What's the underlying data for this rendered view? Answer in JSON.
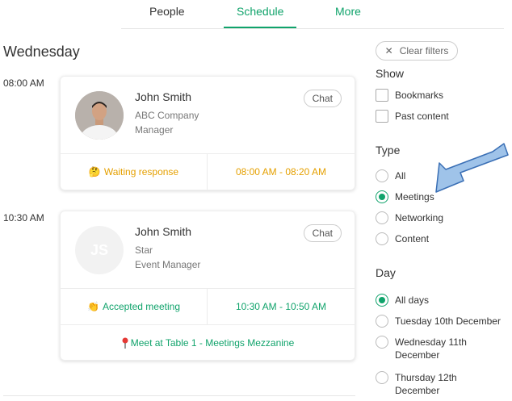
{
  "tabs": [
    {
      "label": "People"
    },
    {
      "label": "Schedule"
    },
    {
      "label": "More"
    }
  ],
  "day_title": "Wednesday",
  "meetings": [
    {
      "time": "08:00 AM",
      "name": "John Smith",
      "line1": "ABC Company",
      "line2": "Manager",
      "chat": "Chat",
      "status_emoji": "🤔",
      "status": "Waiting response",
      "range": "08:00 AM - 08:20 AM",
      "status_color": "#e5a000"
    },
    {
      "time": "10:30 AM",
      "name": "John Smith",
      "initials": "JS",
      "line1": "Star",
      "line2": "Event Manager",
      "chat": "Chat",
      "status_emoji": "👏",
      "status": "Accepted meeting",
      "range": "10:30 AM - 10:50 AM",
      "status_color": "#10a36b",
      "location": "Meet at Table 1 - Meetings Mezzanine"
    }
  ],
  "filters": {
    "clear_label": "Clear filters",
    "show_title": "Show",
    "show_options": [
      "Bookmarks",
      "Past content"
    ],
    "type_title": "Type",
    "type_options": [
      "All",
      "Meetings",
      "Networking",
      "Content"
    ],
    "type_selected": "Meetings",
    "day_title": "Day",
    "day_options": [
      "All days",
      "Tuesday 10th December",
      "Wednesday 11th",
      "December",
      "Thursday 12th",
      "December"
    ],
    "day_selected": "All days"
  },
  "colors": {
    "accent": "#10a36b",
    "waiting": "#e5a000",
    "arrow_fill": "#9fc3e9",
    "arrow_stroke": "#3a6fb5"
  }
}
